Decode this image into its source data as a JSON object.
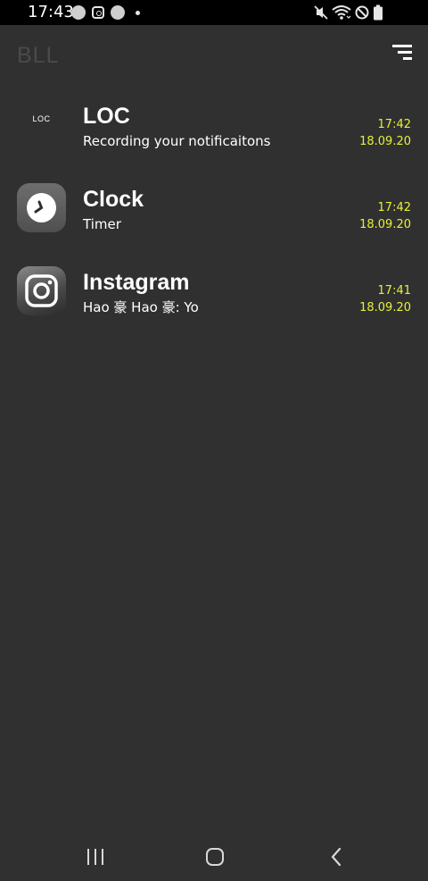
{
  "status_bar": {
    "time": "17:43",
    "left_icons": [
      "notification-dot-icon",
      "instagram-icon",
      "notification-dot-icon",
      "small-dot-icon"
    ],
    "right_icons": [
      "mute-icon",
      "wifi-icon",
      "do-not-disturb-icon",
      "battery-icon"
    ]
  },
  "app_bar": {
    "title": "BLL",
    "sort_icon": "sort-icon"
  },
  "notifications": [
    {
      "icon": "loc-text-icon",
      "icon_text": "LOC",
      "title": "LOC",
      "subtitle": "Recording your notificaitons",
      "time": "17:42",
      "date": "18.09.20"
    },
    {
      "icon": "clock-icon",
      "title": "Clock",
      "subtitle": "Timer",
      "time": "17:42",
      "date": "18.09.20"
    },
    {
      "icon": "instagram-icon",
      "title": "Instagram",
      "subtitle": "Hao 豪 Hao 豪: Yo",
      "time": "17:41",
      "date": "18.09.20"
    }
  ],
  "nav_bar": {
    "icons": [
      "recent-apps-icon",
      "home-icon",
      "back-icon"
    ]
  },
  "colors": {
    "background": "#303030",
    "status_bar": "#000000",
    "accent_time": "#e6f03a",
    "title_muted": "#4a4a4a"
  }
}
